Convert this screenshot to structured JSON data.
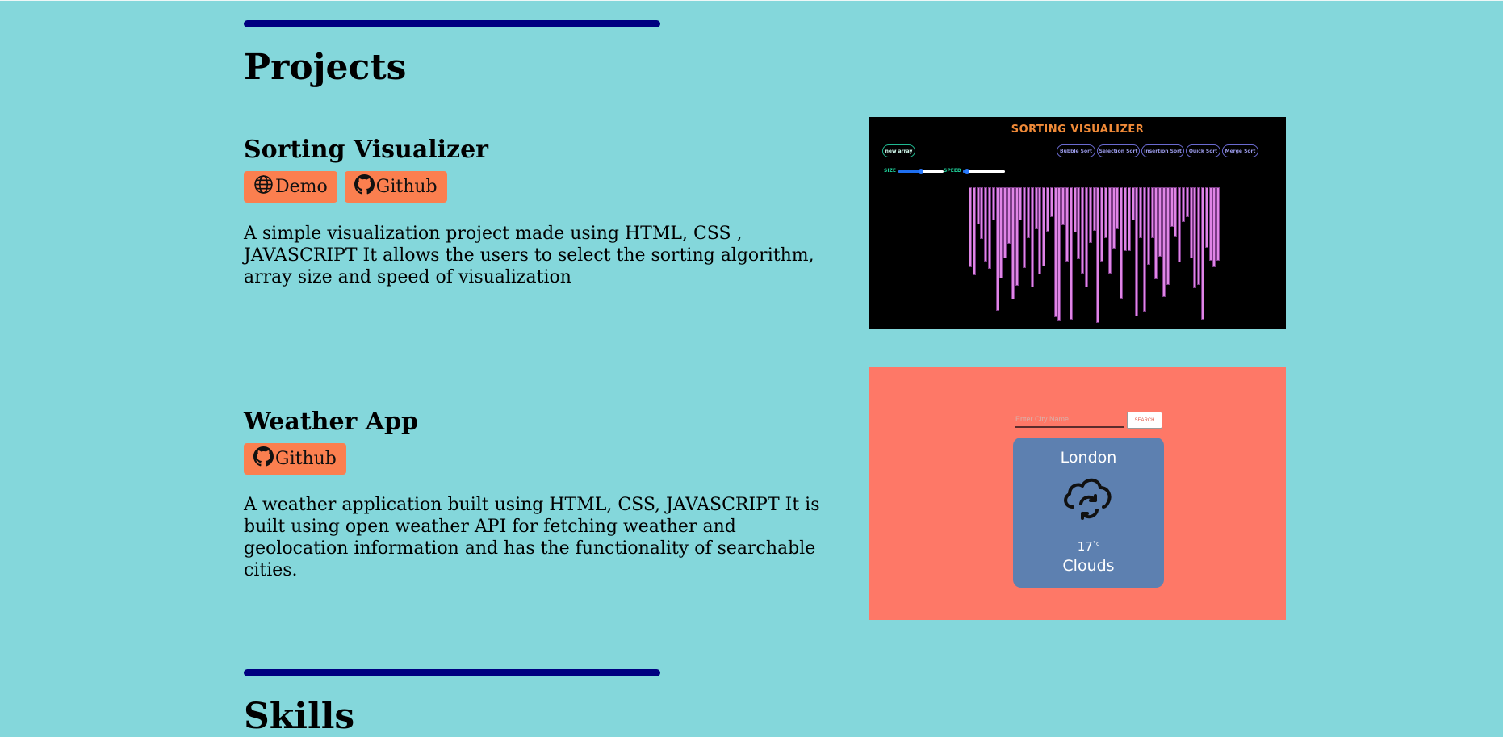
{
  "projects_section": {
    "title": "Projects"
  },
  "projects": [
    {
      "title": "Sorting Visualizer",
      "buttons": [
        {
          "label": "Demo",
          "icon": "globe-icon"
        },
        {
          "label": "Github",
          "icon": "github-icon"
        }
      ],
      "description": "A simple visualization project made using HTML, CSS , JAVASCRIPT It allows the users to select the sorting algorithm, array size and speed of visualization",
      "screenshot": {
        "title": "SORTING VISUALIZER",
        "new_array": "new array",
        "algorithms": [
          "Bubble Sort",
          "Selection Sort",
          "Insertion Sort",
          "Quick Sort",
          "Merge Sort"
        ],
        "size_label": "SIZE",
        "speed_label": "SPEED",
        "size_level": 0.5,
        "speed_level": 0.1,
        "bar_color": "#e085e6"
      }
    },
    {
      "title": "Weather App",
      "buttons": [
        {
          "label": "Github",
          "icon": "github-icon"
        }
      ],
      "description": "A weather application built using HTML, CSS, JAVASCRIPT It is built using open weather API for fetching weather and geolocation information and has the functionality of searchable cities.",
      "screenshot": {
        "input_placeholder": "Enter City Name",
        "search_label": "SEARCH",
        "city": "London",
        "temperature": "17",
        "temp_unit": "°c",
        "condition": "Clouds",
        "condition_icon": "cloud-refresh-icon",
        "background_color": "#fe7867",
        "card_color": "#5d80b0"
      }
    }
  ],
  "skills_section": {
    "title": "Skills"
  },
  "colors": {
    "page_background": "#84d7db",
    "divider": "#000080",
    "button": "#fb7f4f"
  }
}
